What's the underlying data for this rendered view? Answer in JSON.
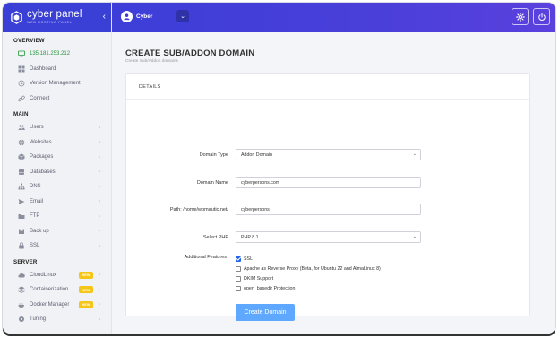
{
  "brand": {
    "name": "cyber panel",
    "tagline": "WEB HOSTING PANEL",
    "collapse_icon": "chevron-left-icon",
    "accent": "#3a3fd6"
  },
  "sidebar": {
    "sections": [
      {
        "title": "OVERVIEW",
        "items": [
          {
            "label": "135.181.253.212",
            "icon": "monitor-icon",
            "arrow": false
          },
          {
            "label": "Dashboard",
            "icon": "dashboard-icon",
            "arrow": false
          },
          {
            "label": "Version Management",
            "icon": "version-icon",
            "arrow": false
          },
          {
            "label": "Connect",
            "icon": "link-icon",
            "arrow": false
          }
        ]
      },
      {
        "title": "MAIN",
        "items": [
          {
            "label": "Users",
            "icon": "users-icon",
            "arrow": true
          },
          {
            "label": "Websites",
            "icon": "globe-icon",
            "arrow": true
          },
          {
            "label": "Packages",
            "icon": "package-icon",
            "arrow": true
          },
          {
            "label": "Databases",
            "icon": "database-icon",
            "arrow": true
          },
          {
            "label": "DNS",
            "icon": "sitemap-icon",
            "arrow": true
          },
          {
            "label": "Email",
            "icon": "email-icon",
            "arrow": true
          },
          {
            "label": "FTP",
            "icon": "ftp-icon",
            "arrow": true
          },
          {
            "label": "Back up",
            "icon": "backup-icon",
            "arrow": true
          },
          {
            "label": "SSL",
            "icon": "lock-icon",
            "arrow": true
          }
        ]
      },
      {
        "title": "SERVER",
        "items": [
          {
            "label": "CloudLinux",
            "icon": "cloud-icon",
            "arrow": true,
            "badge": "NEW"
          },
          {
            "label": "Containerization",
            "icon": "container-icon",
            "arrow": true,
            "badge": "NEW"
          },
          {
            "label": "Docker Manager",
            "icon": "docker-icon",
            "arrow": true,
            "badge": "NEW"
          },
          {
            "label": "Tuning",
            "icon": "tuning-icon",
            "arrow": true
          }
        ]
      }
    ]
  },
  "topbar": {
    "user_name": "Cyber",
    "dropdown_icon": "chevron-down-icon",
    "settings_icon": "gear-icon",
    "power_icon": "power-icon"
  },
  "page": {
    "title": "CREATE SUB/ADDON DOMAIN",
    "subtitle": "Create Sub/Addon domains"
  },
  "form": {
    "section_title": "DETAILS",
    "domain_type": {
      "label": "Domain Type",
      "value": "Addon Domain"
    },
    "domain_name": {
      "label": "Domain Name",
      "value": "cyberpersons.com"
    },
    "path": {
      "label": "Path: /home/wpmautic.net/",
      "value": "cyberpersons"
    },
    "php": {
      "label": "Select PHP",
      "value": "PHP 8.1"
    },
    "features": {
      "label": "Additional Features",
      "options": [
        {
          "label": "SSL",
          "checked": true
        },
        {
          "label": "Apache as Reverse Proxy (Beta, for Ubuntu 22 and AlmaLinux 8)",
          "checked": false
        },
        {
          "label": "DKIM Support",
          "checked": false
        },
        {
          "label": "open_basedir Protection",
          "checked": false
        }
      ]
    },
    "submit_label": "Create Domain"
  }
}
